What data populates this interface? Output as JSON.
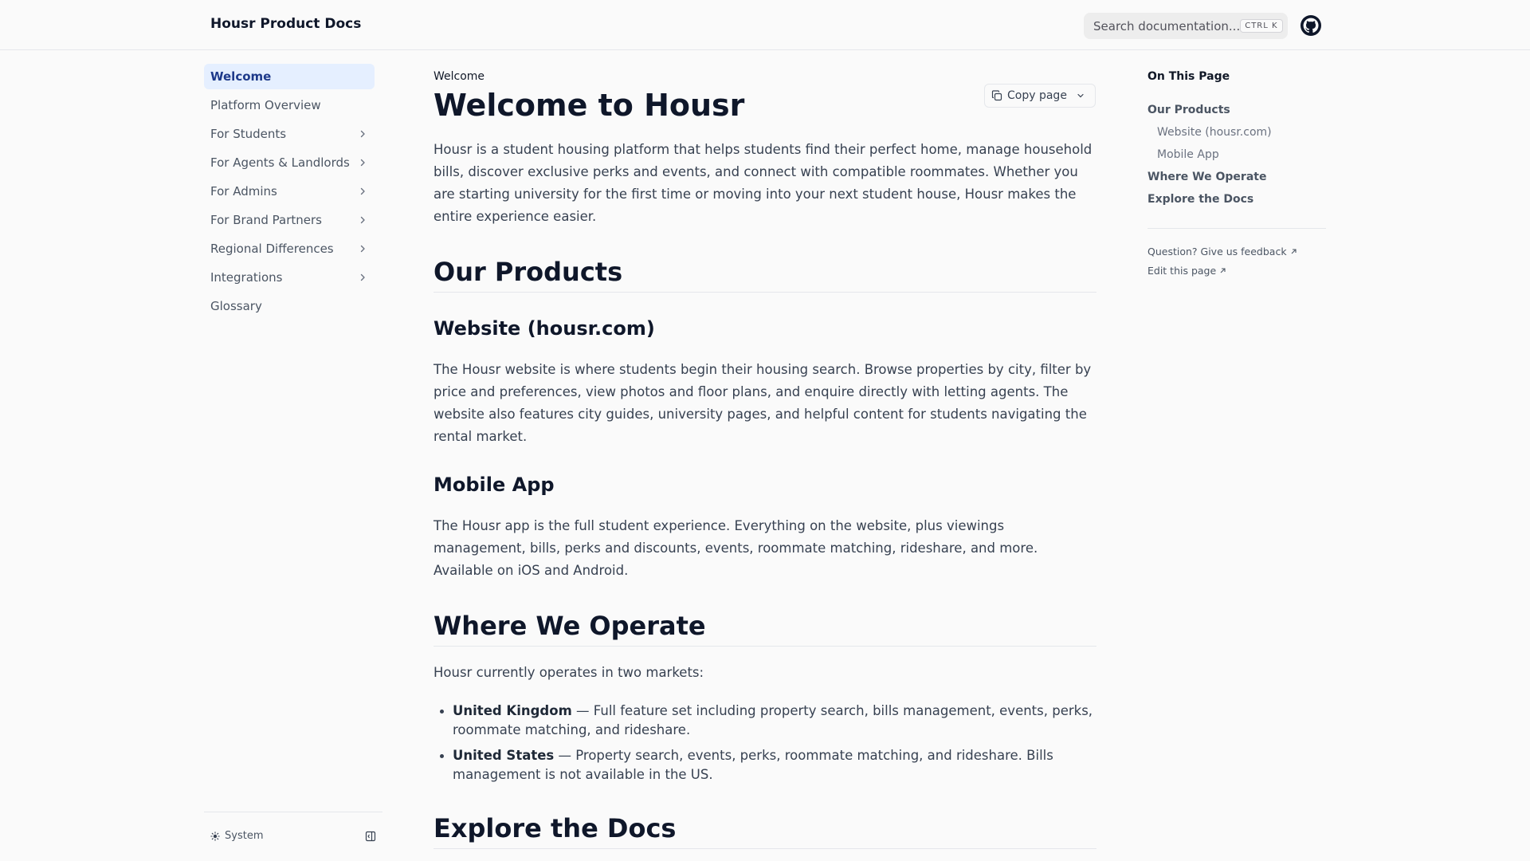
{
  "header": {
    "site_title": "Housr Product Docs",
    "search_placeholder": "Search documentation...",
    "search_shortcut": "CTRL K"
  },
  "sidebar": {
    "items": [
      {
        "label": "Welcome",
        "active": true,
        "has_children": false
      },
      {
        "label": "Platform Overview",
        "active": false,
        "has_children": false
      },
      {
        "label": "For Students",
        "active": false,
        "has_children": true
      },
      {
        "label": "For Agents & Landlords",
        "active": false,
        "has_children": true
      },
      {
        "label": "For Admins",
        "active": false,
        "has_children": true
      },
      {
        "label": "For Brand Partners",
        "active": false,
        "has_children": true
      },
      {
        "label": "Regional Differences",
        "active": false,
        "has_children": true
      },
      {
        "label": "Integrations",
        "active": false,
        "has_children": true
      },
      {
        "label": "Glossary",
        "active": false,
        "has_children": false
      }
    ],
    "footer": {
      "theme_label": "System"
    }
  },
  "main": {
    "breadcrumb": "Welcome",
    "copy_button_label": "Copy page",
    "title": "Welcome to Housr",
    "intro": "Housr is a student housing platform that helps students find their perfect home, manage household bills, discover exclusive perks and events, and connect with compatible roommates. Whether you are starting university for the first time or moving into your next student house, Housr makes the entire experience easier.",
    "products_heading": "Our Products",
    "website_heading": "Website (housr.com)",
    "website_text": "The Housr website is where students begin their housing search. Browse properties by city, filter by price and preferences, view photos and floor plans, and enquire directly with letting agents. The website also features city guides, university pages, and helpful content for students navigating the rental market.",
    "app_heading": "Mobile App",
    "app_text": "The Housr app is the full student experience. Everything on the website, plus viewings management, bills, perks and discounts, events, roommate matching, rideshare, and more. Available on iOS and Android.",
    "operate_heading": "Where We Operate",
    "operate_text": "Housr currently operates in two markets:",
    "markets": [
      {
        "name": "United Kingdom",
        "desc": " — Full feature set including property search, bills management, events, perks, roommate matching, and rideshare."
      },
      {
        "name": "United States",
        "desc": " — Property search, events, perks, roommate matching, and rideshare. Bills management is not available in the US."
      }
    ],
    "explore_heading": "Explore the Docs"
  },
  "toc": {
    "title": "On This Page",
    "items": [
      {
        "label": "Our Products",
        "level": 1
      },
      {
        "label": "Website (housr.com)",
        "level": 2
      },
      {
        "label": "Mobile App",
        "level": 2
      },
      {
        "label": "Where We Operate",
        "level": 1
      },
      {
        "label": "Explore the Docs",
        "level": 1
      }
    ],
    "feedback_link": "Question? Give us feedback",
    "edit_link": "Edit this page"
  }
}
